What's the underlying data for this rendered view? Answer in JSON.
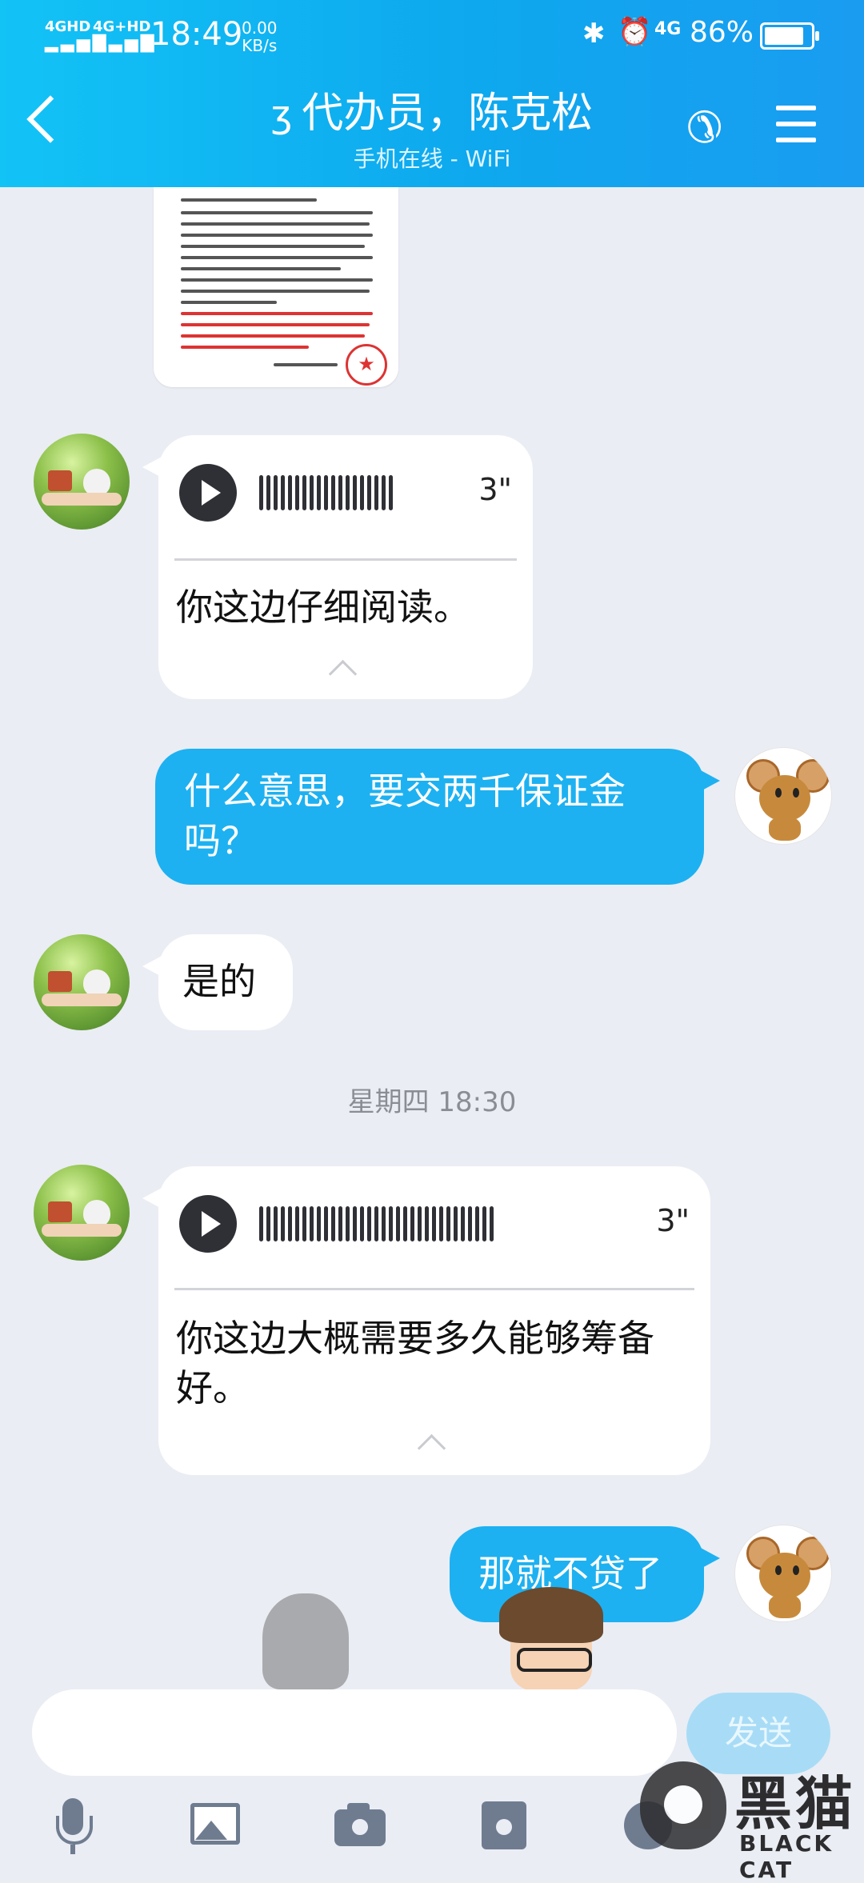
{
  "status_bar": {
    "network1": "4GHD",
    "network2": "4G+HD",
    "time": "18:49",
    "speed_value": "0.00",
    "speed_unit": "KB/s",
    "signal": "4G",
    "battery_text": "86%",
    "battery_level": 0.86
  },
  "header": {
    "title": "代办员，陈克松",
    "subtitle": "手机在线 - WiFi",
    "ear_icon": "ear-icon",
    "back_icon": "back-arrow-icon",
    "phone_icon": "phone-icon",
    "menu_icon": "menu-icon"
  },
  "messages": [
    {
      "type": "voice",
      "side": "left",
      "duration": "3\"",
      "text": "你这边仔细阅读。"
    },
    {
      "type": "text",
      "side": "right",
      "text": "什么意思，要交两千保证金吗？"
    },
    {
      "type": "text",
      "side": "left",
      "text": "是的"
    },
    {
      "type": "voice",
      "side": "left",
      "duration": "3\"",
      "text": "你这边大概需要多久能够筹备好。"
    },
    {
      "type": "text",
      "side": "right",
      "text": "那就不贷了"
    }
  ],
  "timestamp": "星期四 18:30",
  "composer": {
    "placeholder": "",
    "send_label": "发送"
  },
  "toolbar": [
    "mic-icon",
    "image-icon",
    "camera-icon",
    "red-packet-icon",
    "emoji-icon"
  ],
  "watermark": {
    "cn": "黑猫",
    "en": "BLACK CAT"
  },
  "colors": {
    "header": "#12c3f6",
    "bubble_out": "#1db1f1",
    "bubble_in": "#ffffff",
    "background": "#eaedf4",
    "send_button": "#a8dcf6"
  }
}
